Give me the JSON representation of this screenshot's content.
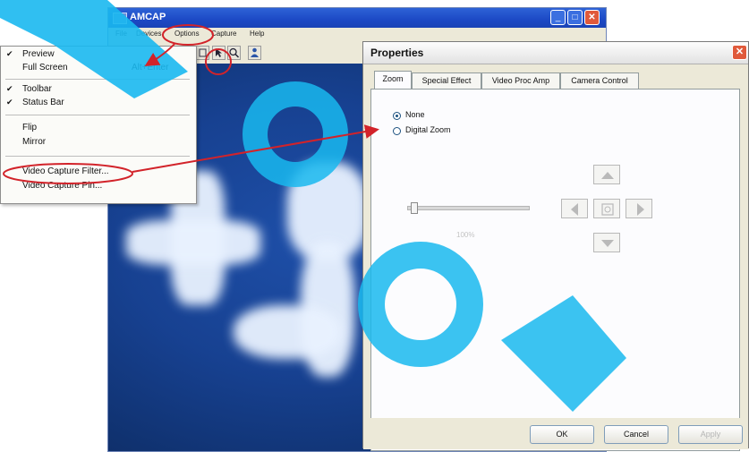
{
  "amcap": {
    "title": "AMCAP",
    "menubar": [
      "File",
      "Devices",
      "Options",
      "Capture",
      "Help"
    ],
    "window_buttons": {
      "minimize": "_",
      "maximize": "□",
      "close": "✕"
    }
  },
  "options_menu": {
    "items": [
      {
        "label": "Preview",
        "checked": true,
        "shortcut": ""
      },
      {
        "label": "Full Screen",
        "checked": false,
        "shortcut": "Alt+Enter"
      },
      {
        "label": "Toolbar",
        "checked": true,
        "shortcut": ""
      },
      {
        "label": "Status Bar",
        "checked": true,
        "shortcut": ""
      },
      {
        "label": "Flip",
        "checked": false,
        "shortcut": ""
      },
      {
        "label": "Mirror",
        "checked": false,
        "shortcut": ""
      },
      {
        "label": "Video Capture Filter...",
        "checked": false,
        "shortcut": ""
      },
      {
        "label": "Video Capture Pin...",
        "checked": false,
        "shortcut": ""
      }
    ],
    "check_glyph": "✔"
  },
  "properties": {
    "title": "Properties",
    "close_glyph": "✕",
    "tabs": [
      "Zoom",
      "Special Effect",
      "Video Proc Amp",
      "Camera Control"
    ],
    "active_tab": "Zoom",
    "zoom_options": [
      "None",
      "Digital Zoom"
    ],
    "selected_zoom_option": "None",
    "zoom_level": "100%",
    "buttons": {
      "ok": "OK",
      "cancel": "Cancel",
      "apply": "Apply"
    }
  },
  "colors": {
    "annotation_red": "#d2232a",
    "watermark_cyan": "#19b8ef",
    "xp_title_blue": "#1c49c5"
  }
}
